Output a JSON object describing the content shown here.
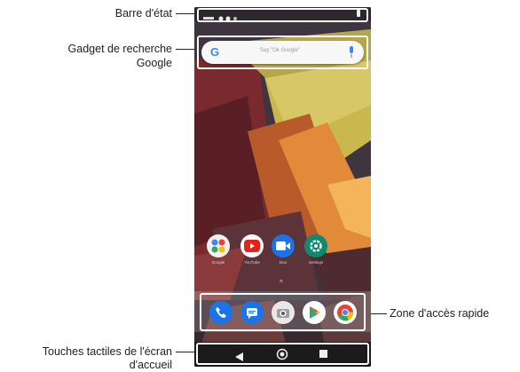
{
  "annotations": {
    "status_bar": "Barre d'état",
    "google_widget_line1": "Gadget de recherche",
    "google_widget_line2": "Google",
    "quick_access": "Zone d'accès rapide",
    "home_touch_line1": "Touches tactiles de l'écran",
    "home_touch_line2": "d'accueil"
  },
  "search_widget": {
    "logo": "G",
    "placeholder": "Say \"Ok Google\""
  },
  "home_apps": [
    {
      "label": "Google",
      "icon": "google-folder-icon"
    },
    {
      "label": "YouTube",
      "icon": "youtube-icon"
    },
    {
      "label": "Duo",
      "icon": "duo-icon"
    },
    {
      "label": "Settings",
      "icon": "settings-icon"
    }
  ],
  "dock_apps": [
    {
      "icon": "phone-icon"
    },
    {
      "icon": "messages-icon"
    },
    {
      "icon": "camera-icon"
    },
    {
      "icon": "play-store-icon"
    },
    {
      "icon": "chrome-icon"
    }
  ],
  "nav_keys": [
    "back-icon",
    "home-icon",
    "recents-icon"
  ],
  "colors": {
    "highlight": "#ffffff",
    "youtube": "#e62117",
    "duo": "#1a73e8",
    "settings": "#0f8a6e",
    "phone": "#1a73e8",
    "messages": "#1a73e8"
  }
}
